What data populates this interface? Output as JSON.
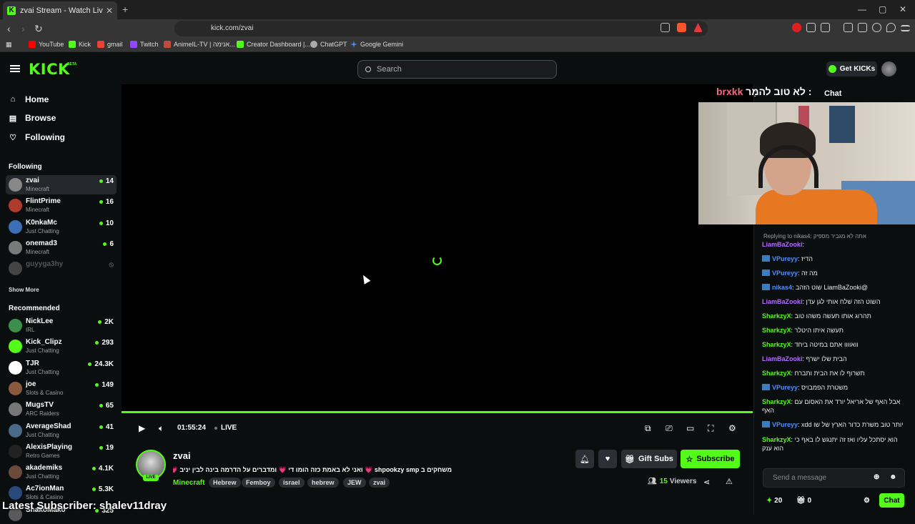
{
  "browser": {
    "tab_title": "zvai Stream - Watch Live on Kick",
    "tab_icon": "kick-favicon",
    "url": "kick.com/zvai",
    "bookmarks": [
      {
        "label": "YouTube",
        "color": "#ff0000"
      },
      {
        "label": "Kick",
        "color": "#53fc18"
      },
      {
        "label": "gmail",
        "color": "#ea4335"
      },
      {
        "label": "Twitch",
        "color": "#9146ff"
      },
      {
        "label": "AnimeIL-TV | אנימה...",
        "color": "#c14b3a"
      },
      {
        "label": "Creator Dashboard |...",
        "color": "#53fc18"
      },
      {
        "label": "ChatGPT",
        "color": "#aaaaaa"
      },
      {
        "label": "Google Gemini",
        "color": "#4c8bf5"
      }
    ]
  },
  "header": {
    "logo": "KICK",
    "logo_badge": "BETA",
    "search_placeholder": "Search",
    "get_kicks": "Get KICKs"
  },
  "sidebar": {
    "nav": [
      {
        "label": "Home",
        "icon": "home-icon"
      },
      {
        "label": "Browse",
        "icon": "browse-icon"
      },
      {
        "label": "Following",
        "icon": "heart-icon"
      }
    ],
    "following_title": "Following",
    "following": [
      {
        "name": "zvai",
        "category": "Minecraft",
        "viewers": "14",
        "color": "#888"
      },
      {
        "name": "FlintPrime",
        "category": "Minecraft",
        "viewers": "16",
        "color": "#b03a2e"
      },
      {
        "name": "K0nkaMc",
        "category": "Just Chatting",
        "viewers": "10",
        "color": "#3d6fb6"
      },
      {
        "name": "onemad3",
        "category": "Minecraft",
        "viewers": "6",
        "color": "#7a7a7a"
      },
      {
        "name": "guyyga3hy",
        "category": "",
        "viewers": "",
        "color": "#444"
      }
    ],
    "show_more": "Show More",
    "recommended_title": "Recommended",
    "recommended": [
      {
        "name": "NickLee",
        "category": "IRL",
        "viewers": "2K",
        "color": "#3b8f4a"
      },
      {
        "name": "Kick_Clipz",
        "category": "Just Chatting",
        "viewers": "293",
        "color": "#53fc18"
      },
      {
        "name": "TJR",
        "category": "Just Chatting",
        "viewers": "24.3K",
        "color": "#ffffff"
      },
      {
        "name": "joe",
        "category": "Slots & Casino",
        "viewers": "149",
        "color": "#8a5a3c"
      },
      {
        "name": "MugsTV",
        "category": "ARC Raiders",
        "viewers": "65",
        "color": "#777"
      },
      {
        "name": "AverageShad",
        "category": "Just Chatting",
        "viewers": "41",
        "color": "#4a6a8a"
      },
      {
        "name": "AlexisPlaying",
        "category": "Retro Games",
        "viewers": "19",
        "color": "#222"
      },
      {
        "name": "akademiks",
        "category": "Just Chatting",
        "viewers": "4.1K",
        "color": "#6a4a3a"
      },
      {
        "name": "Ac7ionMan",
        "category": "Slots & Casino",
        "viewers": "5.3K",
        "color": "#2a4a7a"
      },
      {
        "name": "ShakoMako",
        "category": "",
        "viewers": "325",
        "color": "#5a5a5a"
      }
    ]
  },
  "player": {
    "time": "01:55:24",
    "live_label": "LIVE",
    "progress": 1.0
  },
  "stream": {
    "streamer": "zvai",
    "live_badge": "LIVE",
    "title": "משחקים ב shpookzy smp 💗 ואני לא באמת כזה הומו די 💗 ומדברים על הדרמה בינה לבין יניב 💗 💗",
    "category": "Minecraft",
    "tags": [
      "Hebrew",
      "Femboy",
      "israel",
      "hebrew",
      "JEW",
      "zvai"
    ],
    "gift_subs": "Gift Subs",
    "subscribe": "Subscribe",
    "viewers_count": "15",
    "viewers_label": "Viewers"
  },
  "overlay": {
    "latest_subscriber": "Latest Subscriber: shalev11dray",
    "stream_title_user": "brxkk",
    "stream_title_text": "לא טוב להמַּר :"
  },
  "chat": {
    "title": "Chat",
    "reply_to": "Replying to nikas4: אתה לא מגביר מספיק",
    "messages": [
      {
        "user": "LiamBaZooki",
        "color": "#b06cff",
        "text": "",
        "badge": false
      },
      {
        "user": "VPureyy",
        "color": "#4f8ef7",
        "text": "הדיז",
        "badge": true
      },
      {
        "user": "VPureyy",
        "color": "#4f8ef7",
        "text": "מה זה",
        "badge": true
      },
      {
        "user": "nikas4",
        "color": "#4f8ef7",
        "text": "@LiamBaZooki שוט הזהב",
        "badge": true
      },
      {
        "user": "LiamBaZooki",
        "color": "#b06cff",
        "text": "השוט הזה שלח אותי לגן עדן",
        "badge": false
      },
      {
        "user": "SharkzyX",
        "color": "#53fc18",
        "text": "תהרוג אותו תעשה משהו טוב",
        "badge": false
      },
      {
        "user": "SharkzyX",
        "color": "#53fc18",
        "text": "תעשה איתו היטלר",
        "badge": false
      },
      {
        "user": "SharkzyX",
        "color": "#53fc18",
        "text": "וואוווו אתם במיטה ביחד",
        "badge": false
      },
      {
        "user": "LiamBaZooki",
        "color": "#b06cff",
        "text": "הבית שלו ישרף",
        "badge": false
      },
      {
        "user": "SharkzyX",
        "color": "#53fc18",
        "text": "תשרוף לו את הבית ותברח",
        "badge": false
      },
      {
        "user": "VPureyy",
        "color": "#4f8ef7",
        "text": "משטרת הפמבויס",
        "badge": true
      },
      {
        "user": "SharkzyX",
        "color": "#53fc18",
        "text": "אבל האף של אריאל יורד את האסום עם האף",
        "badge": false
      },
      {
        "user": "VPureyy",
        "color": "#4f8ef7",
        "text": "יותר טוב משרת כדור הארץ של שו xdd",
        "badge": true
      },
      {
        "user": "SharkzyX",
        "color": "#53fc18",
        "text": "הוא יסתכל עליו ואז זה יתנגש לו באף כי הוא ענק",
        "badge": false
      }
    ],
    "input_placeholder": "Send a message",
    "points": "20",
    "gifts": "0",
    "chat_button": "Chat"
  }
}
